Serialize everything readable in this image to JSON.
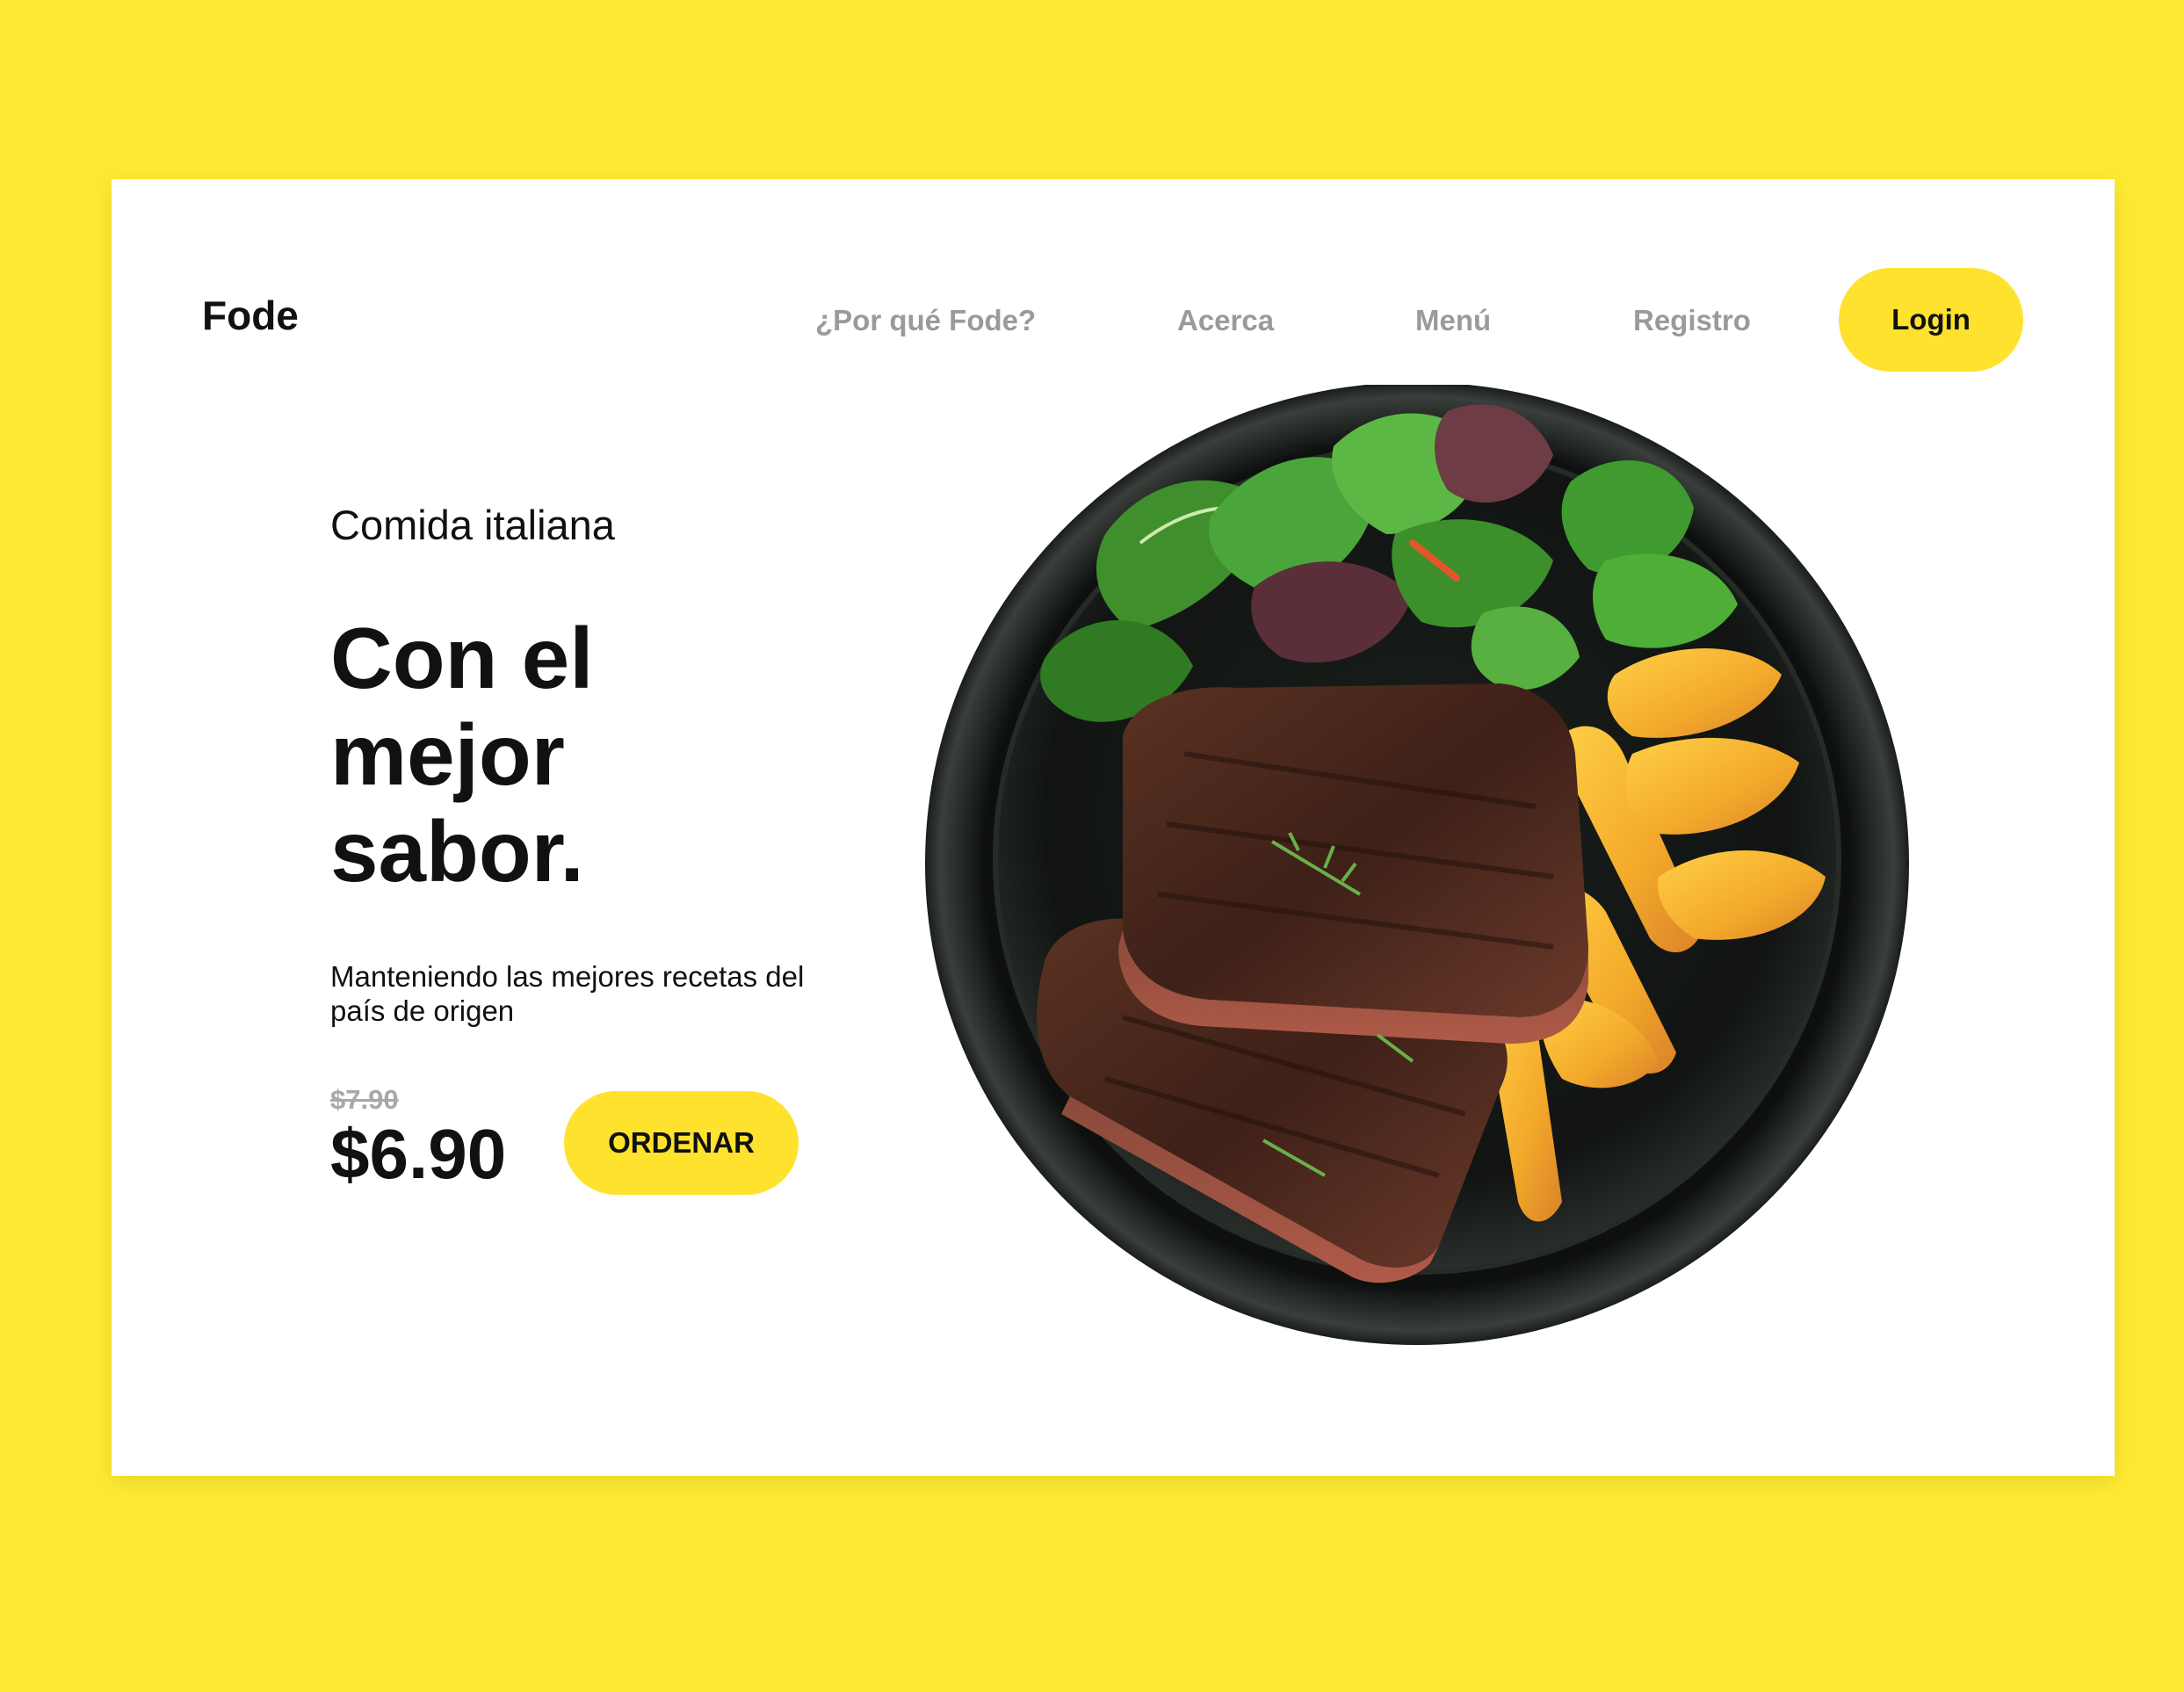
{
  "brand": "Fode",
  "nav": {
    "items": [
      "¿Por qué Fode?",
      "Acerca",
      "Menú",
      "Registro"
    ],
    "login_label": "Login"
  },
  "hero": {
    "eyebrow": "Comida italiana",
    "headline_lines": [
      "Con el",
      "mejor",
      "sabor."
    ],
    "description": "Manteniendo las mejores recetas del país de origen",
    "old_price": "$7.90",
    "price": "$6.90",
    "order_label": "ORDENAR"
  },
  "colors": {
    "background": "#ffea33",
    "accent": "#ffe22e",
    "text": "#111111",
    "muted": "#9a9a9a"
  }
}
